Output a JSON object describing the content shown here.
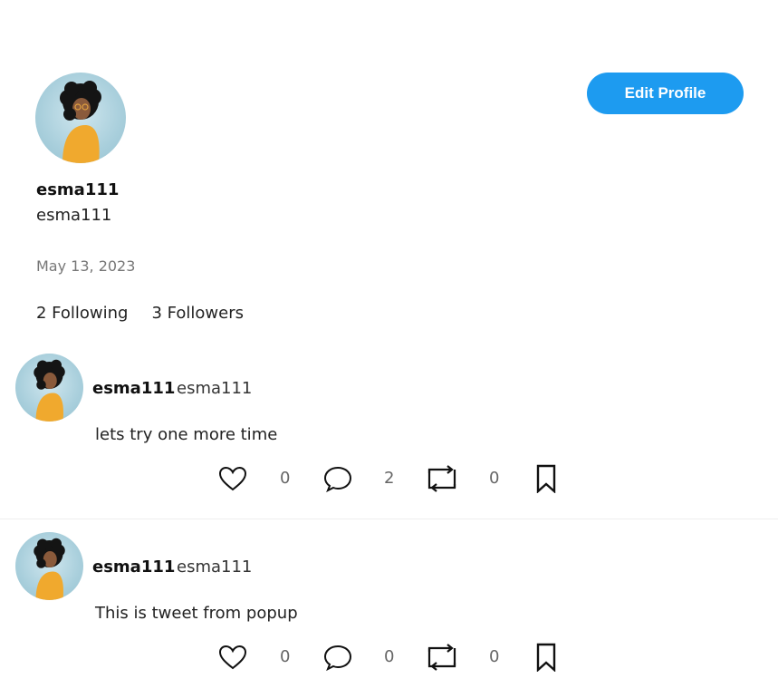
{
  "profile": {
    "display_name": "esma111",
    "handle": "esma111",
    "joined_date": "May 13, 2023",
    "following": "2 Following",
    "followers": "3 Followers",
    "edit_button_label": "Edit Profile"
  },
  "colors": {
    "accent": "#1d9bf0",
    "muted": "#777777"
  },
  "tweets": [
    {
      "display_name": "esma111",
      "handle": "esma111",
      "text": "lets try one more time",
      "likes": "0",
      "comments": "2",
      "retweets": "0"
    },
    {
      "display_name": "esma111",
      "handle": "esma111",
      "text": "This is tweet from popup",
      "likes": "0",
      "comments": "0",
      "retweets": "0"
    }
  ],
  "icons": [
    "heart-icon",
    "comment-icon",
    "retweet-icon",
    "bookmark-icon"
  ]
}
